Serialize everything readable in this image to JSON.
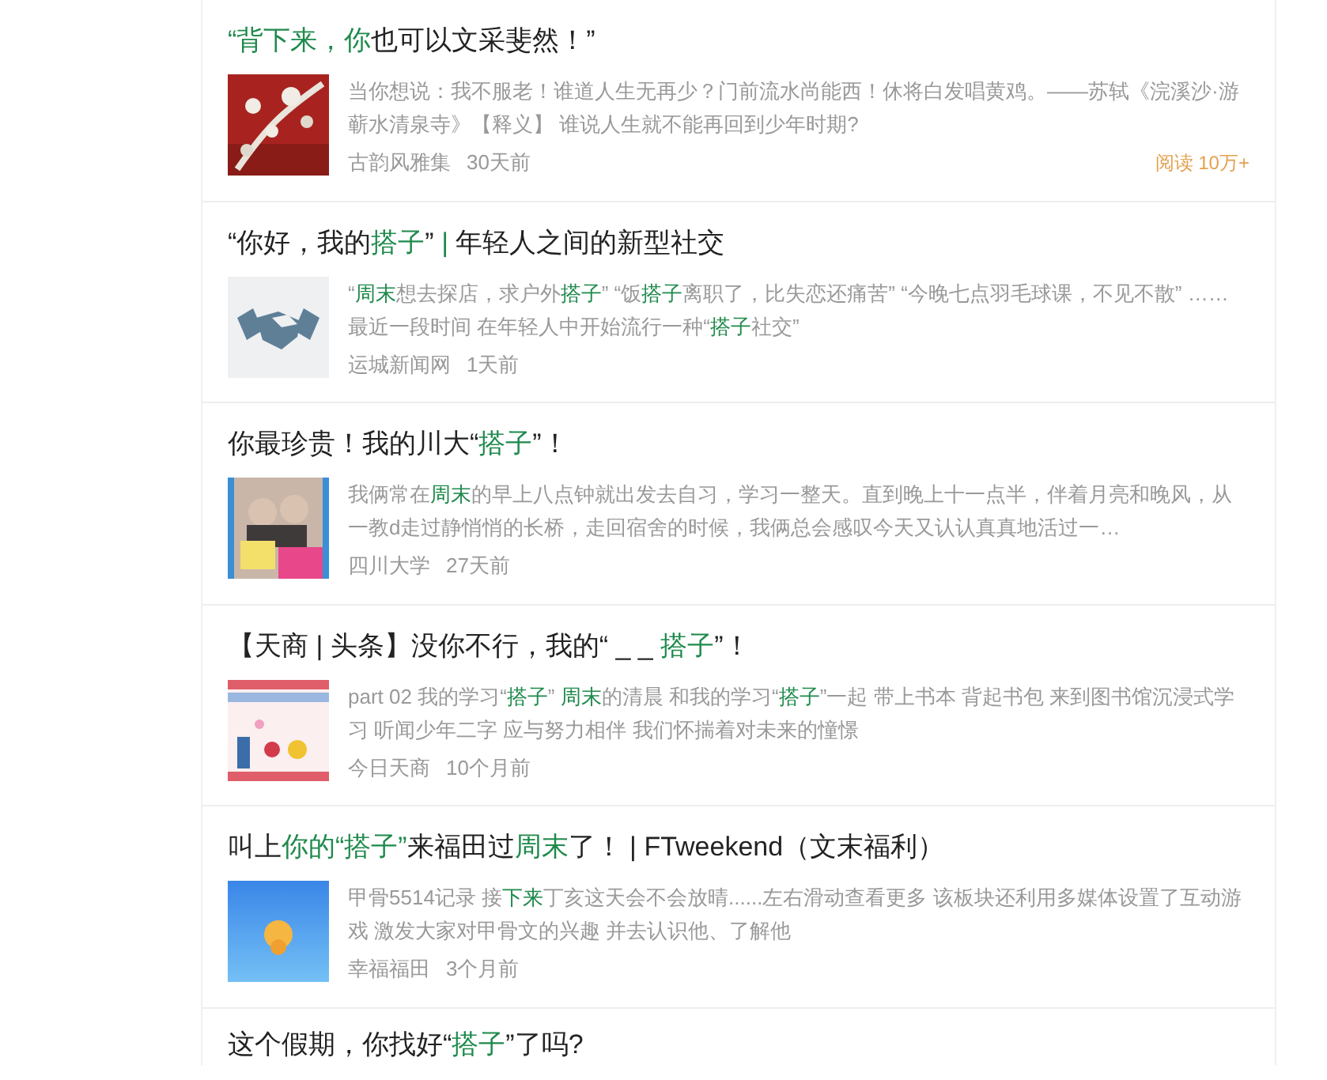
{
  "articles": [
    {
      "title": [
        {
          "text": "“背下来，你",
          "highlight": true
        },
        {
          "text": "也可以文采斐然！”",
          "highlight": false
        }
      ],
      "snippet": [
        {
          "text": "当你想说：我不服老！谁道人生无再少？门前流水尚能西！休将白发唱黄鸡。——苏轼《浣溪沙·游蕲水清泉寺》【释义】 谁说人生就不能再回到少年时期?",
          "highlight": false
        }
      ],
      "thumbnail": {
        "kind": "picture"
      },
      "source": "古韵风雅集",
      "time": "30天前",
      "reads": "阅读 10万+"
    },
    {
      "title": [
        {
          "text": "“你好，我的",
          "highlight": false
        },
        {
          "text": "搭子",
          "highlight": true
        },
        {
          "text": "” ",
          "highlight": false
        },
        {
          "text": "|",
          "highlight": true
        },
        {
          "text": " 年轻人之间的新型社交",
          "highlight": false
        }
      ],
      "snippet": [
        {
          "text": "“",
          "highlight": false
        },
        {
          "text": "周末",
          "highlight": true
        },
        {
          "text": "想去探店，求户外",
          "highlight": false
        },
        {
          "text": "搭子",
          "highlight": true
        },
        {
          "text": "” “饭",
          "highlight": false
        },
        {
          "text": "搭子",
          "highlight": true
        },
        {
          "text": "离职了，比失恋还痛苦” “今晚七点羽毛球课，不见不散” …… 最近一段时间 在年轻人中开始流行一种“",
          "highlight": false
        },
        {
          "text": "搭子",
          "highlight": true
        },
        {
          "text": "社交”",
          "highlight": false
        }
      ],
      "thumbnail": {
        "kind": "picture"
      },
      "source": "运城新闻网",
      "time": "1天前"
    },
    {
      "title": [
        {
          "text": "你最珍贵！我的川大“",
          "highlight": false
        },
        {
          "text": "搭子",
          "highlight": true
        },
        {
          "text": "”！",
          "highlight": false
        }
      ],
      "snippet": [
        {
          "text": "我俩常在",
          "highlight": false
        },
        {
          "text": "周末",
          "highlight": true
        },
        {
          "text": "的早上八点钟就出发去自习，学习一整天。直到晚上十一点半，伴着月亮和晚风，从一教d走过静悄悄的长桥，走回宿舍的时候，我俩总会感叹今天又认认真真地活过一…",
          "highlight": false
        }
      ],
      "thumbnail": {
        "kind": "picture"
      },
      "source": "四川大学",
      "time": "27天前"
    },
    {
      "title": [
        {
          "text": "【天商 | 头条】没你不行，我的“ _ _ ",
          "highlight": false
        },
        {
          "text": "搭子",
          "highlight": true
        },
        {
          "text": "”！",
          "highlight": false
        }
      ],
      "snippet": [
        {
          "text": "part 02 我的学习“",
          "highlight": false
        },
        {
          "text": "搭子",
          "highlight": true
        },
        {
          "text": "” ",
          "highlight": false
        },
        {
          "text": "周末",
          "highlight": true
        },
        {
          "text": "的清晨 和我的学习“",
          "highlight": false
        },
        {
          "text": "搭子",
          "highlight": true
        },
        {
          "text": "”一起 带上书本 背起书包 来到图书馆沉浸式学习 听闻少年二字 应与努力相伴 我们怀揣着对未来的憧憬",
          "highlight": false
        }
      ],
      "thumbnail": {
        "kind": "picture"
      },
      "source": "今日天商",
      "time": "10个月前"
    },
    {
      "title": [
        {
          "text": "叫上",
          "highlight": false
        },
        {
          "text": "你的“搭子”",
          "highlight": true
        },
        {
          "text": "来福田过",
          "highlight": false
        },
        {
          "text": "周末",
          "highlight": true
        },
        {
          "text": "了！ | FTweekend（文末福利）",
          "highlight": false
        }
      ],
      "snippet": [
        {
          "text": "甲骨5514记录 接",
          "highlight": false
        },
        {
          "text": "下来",
          "highlight": true
        },
        {
          "text": "丁亥这天会不会放晴......左右滑动查看更多 该板块还利用多媒体设置了互动游戏 激发大家对甲骨文的兴趣 并去认识他、了解他",
          "highlight": false
        }
      ],
      "thumbnail": {
        "kind": "picture"
      },
      "source": "幸福福田",
      "time": "3个月前"
    },
    {
      "title": [
        {
          "text": "这个假期，你找好“",
          "highlight": false
        },
        {
          "text": "搭子",
          "highlight": true
        },
        {
          "text": "”了吗?",
          "highlight": false
        }
      ]
    }
  ]
}
